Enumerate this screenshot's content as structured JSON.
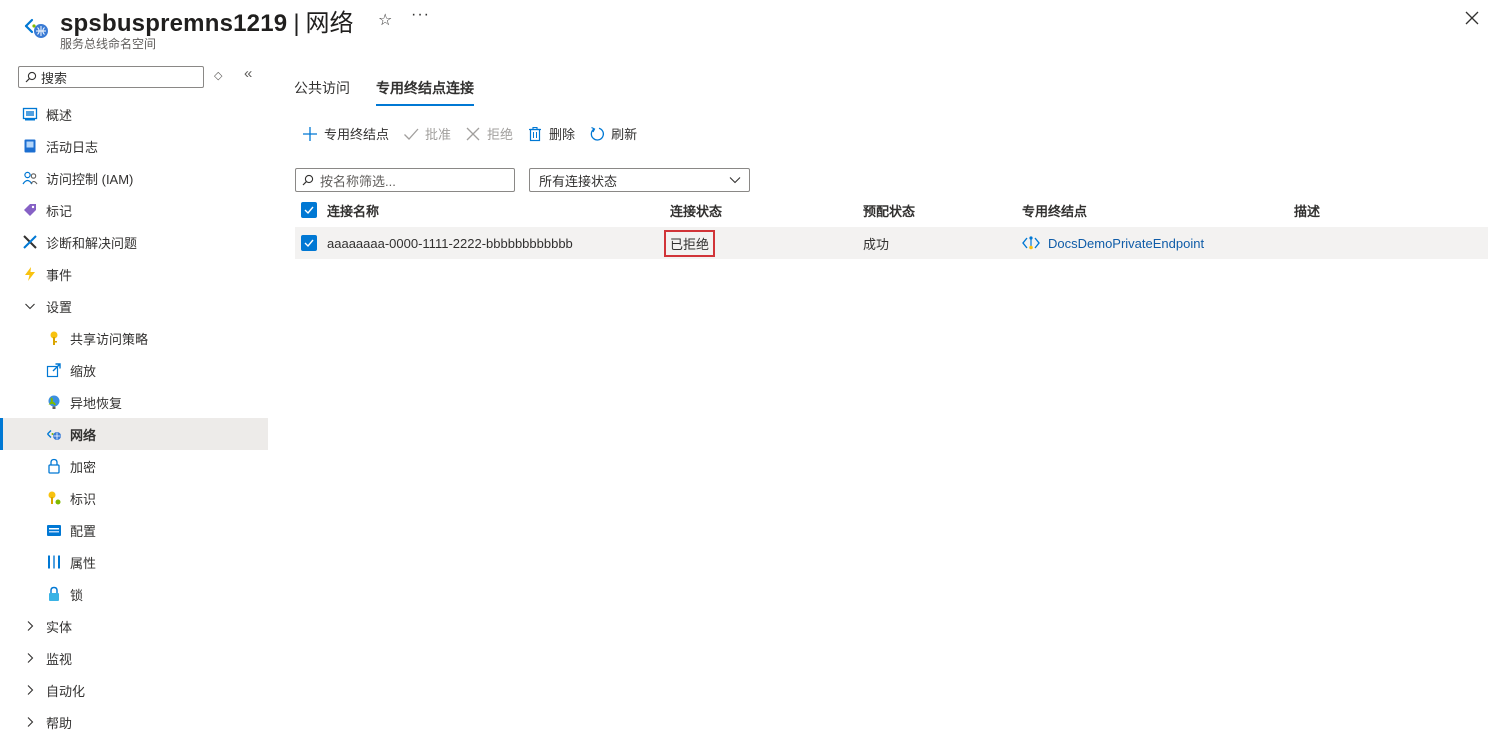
{
  "header": {
    "resource_name": "spsbuspremns1219",
    "separator": "|",
    "page_name": "网络",
    "subtitle": "服务总线命名空间",
    "more": "···"
  },
  "sidebar": {
    "search_placeholder": "搜索",
    "items": [
      {
        "label": "概述",
        "icon": "overview-icon"
      },
      {
        "label": "活动日志",
        "icon": "activity-log-icon"
      },
      {
        "label": "访问控制 (IAM)",
        "icon": "iam-icon"
      },
      {
        "label": "标记",
        "icon": "tag-icon"
      },
      {
        "label": "诊断和解决问题",
        "icon": "diagnose-icon"
      },
      {
        "label": "事件",
        "icon": "lightning-icon"
      },
      {
        "label": "设置",
        "icon": "chevron-down-icon",
        "expanded": true
      },
      {
        "label": "共享访问策略",
        "icon": "key-icon"
      },
      {
        "label": "缩放",
        "icon": "scale-icon"
      },
      {
        "label": "异地恢复",
        "icon": "globe-icon"
      },
      {
        "label": "网络",
        "icon": "network-icon",
        "active": true
      },
      {
        "label": "加密",
        "icon": "lock-icon"
      },
      {
        "label": "标识",
        "icon": "identity-icon"
      },
      {
        "label": "配置",
        "icon": "configuration-icon"
      },
      {
        "label": "属性",
        "icon": "properties-icon"
      },
      {
        "label": "锁",
        "icon": "lock-filled-icon"
      },
      {
        "label": "实体",
        "icon": "chevron-right-icon"
      },
      {
        "label": "监视",
        "icon": "chevron-right-icon"
      },
      {
        "label": "自动化",
        "icon": "chevron-right-icon"
      },
      {
        "label": "帮助",
        "icon": "chevron-right-icon"
      }
    ]
  },
  "tabs": [
    {
      "label": "公共访问",
      "active": false
    },
    {
      "label": "专用终结点连接",
      "active": true
    }
  ],
  "toolbar": {
    "add_label": "专用终结点",
    "approve_label": "批准",
    "reject_label": "拒绝",
    "delete_label": "删除",
    "refresh_label": "刷新"
  },
  "filter": {
    "name_placeholder": "按名称筛选...",
    "state_value": "所有连接状态"
  },
  "table": {
    "columns": [
      "连接名称",
      "连接状态",
      "预配状态",
      "专用终结点",
      "描述"
    ],
    "rows": [
      {
        "name": "aaaaaaaa-0000-1111-2222-bbbbbbbbbbbb",
        "connection_state": "已拒绝",
        "provisioning_state": "成功",
        "private_endpoint": "DocsDemoPrivateEndpoint",
        "description": ""
      }
    ]
  },
  "colors": {
    "accent": "#0078d4",
    "highlight_border": "#d13438",
    "link": "#0f5ca8"
  }
}
